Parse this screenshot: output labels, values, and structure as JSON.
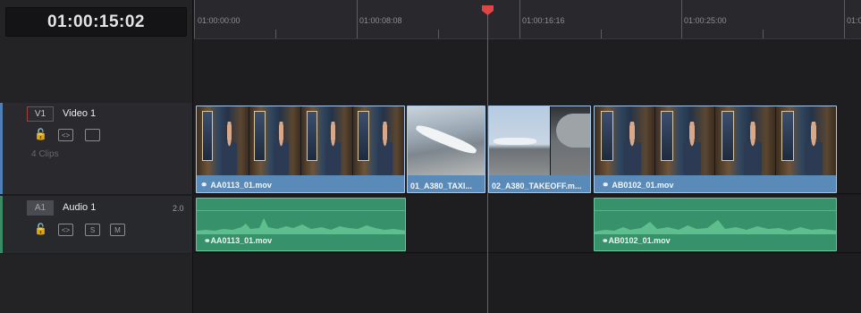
{
  "timecode": "01:00:15:02",
  "ruler": {
    "labels": [
      "01:00:00:00",
      "01:00:08:08",
      "01:00:16:16",
      "01:00:25:00",
      "01:0"
    ]
  },
  "tracks": {
    "video": {
      "badge": "V1",
      "name": "Video 1",
      "clip_count": "4 Clips",
      "icons": [
        "lock-icon",
        "auto-select-icon",
        "monitor-icon"
      ]
    },
    "audio": {
      "badge": "A1",
      "name": "Audio 1",
      "channels": "2.0",
      "icons": [
        "lock-icon",
        "auto-select-icon",
        "solo-button",
        "mute-button"
      ],
      "solo_label": "S",
      "mute_label": "M"
    }
  },
  "video_clips": [
    {
      "name": "AA0113_01.mov",
      "linked": true
    },
    {
      "name": "01_A380_TAXI...",
      "linked": false
    },
    {
      "name": "02_A380_TAKEOFF.m...",
      "linked": false
    },
    {
      "name": "AB0102_01.mov",
      "linked": true
    }
  ],
  "audio_clips": [
    {
      "name": "AA0113_01.mov",
      "linked": true
    },
    {
      "name": "AB0102_01.mov",
      "linked": true
    }
  ],
  "icons": {
    "link": "link-icon",
    "playhead": "playhead-marker-icon"
  },
  "colors": {
    "video_clip": "#5a8ab8",
    "audio_clip": "#37916a",
    "playhead": "#e04545",
    "video_track_accent": "#4f7fb5",
    "audio_track_accent": "#3a8a63"
  }
}
